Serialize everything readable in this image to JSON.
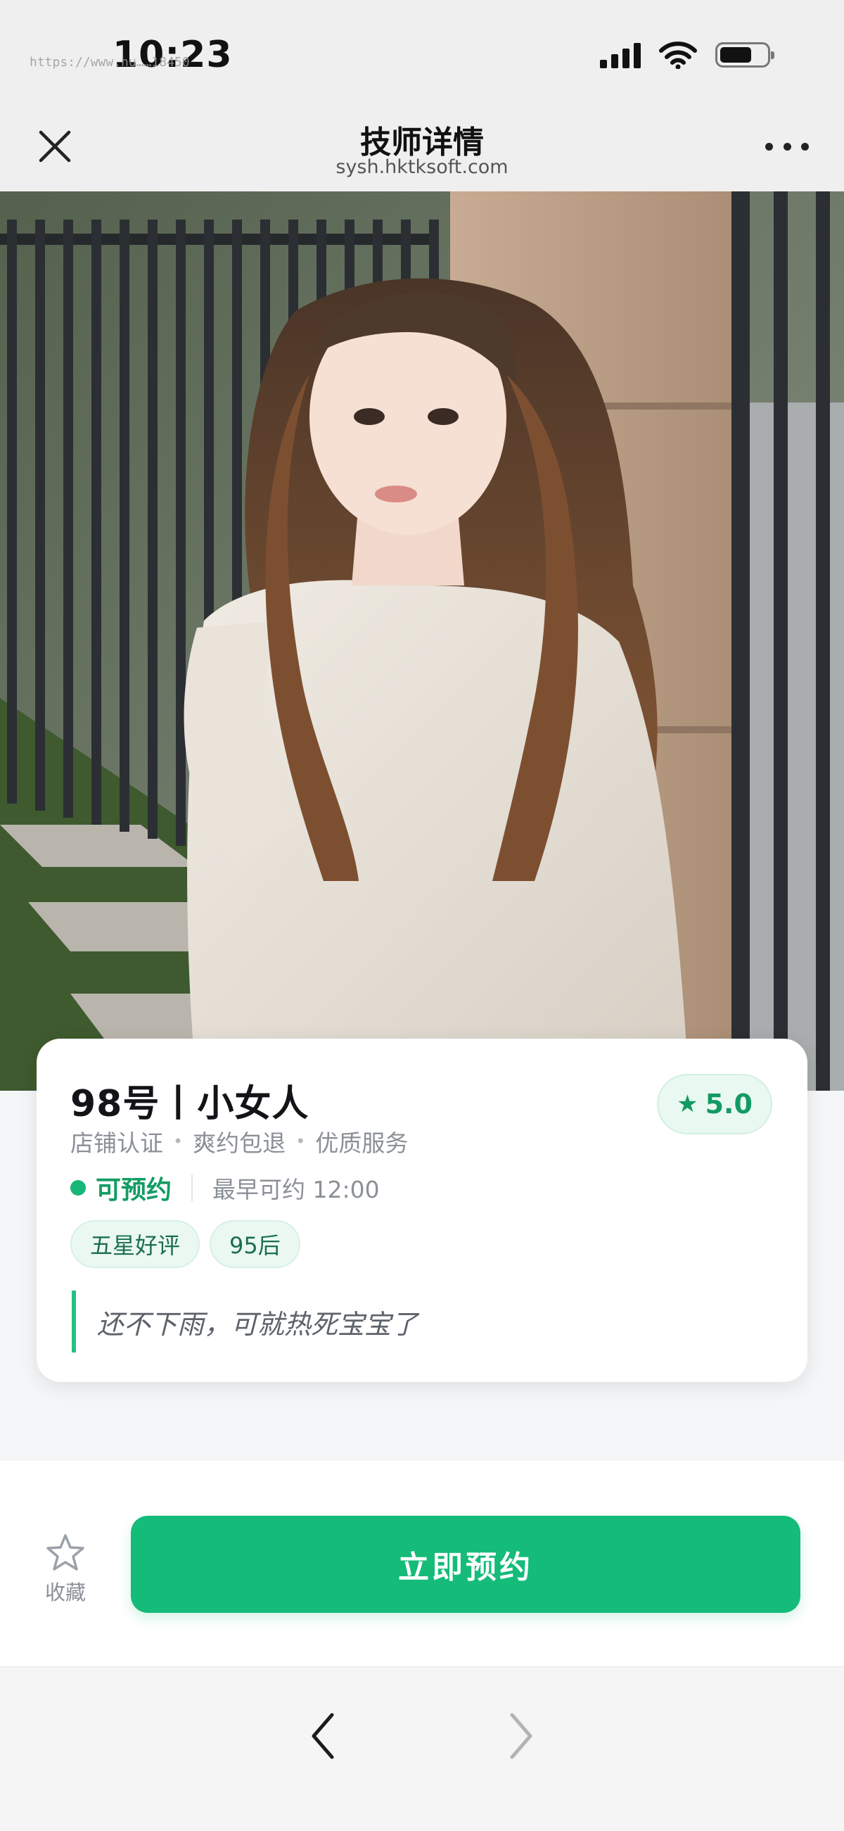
{
  "status_bar": {
    "time": "10:23",
    "url_overlay": "https://www.hu……18450",
    "icons": [
      "cellular-signal-icon",
      "wifi-icon",
      "battery-icon"
    ]
  },
  "nav": {
    "title": "技师详情",
    "subtitle": "sysh.hktksoft.com",
    "icons": [
      "close-icon",
      "more-icon"
    ]
  },
  "profile": {
    "name": "98号丨小女人",
    "rating": "5.0",
    "features": [
      "店铺认证",
      "爽约包退",
      "优质服务"
    ],
    "availability": {
      "status": "可预约",
      "earliest": "最早可约 12:00"
    },
    "tags": [
      "五星好评",
      "95后"
    ],
    "quote": "还不下雨，可就热死宝宝了"
  },
  "actions": {
    "favorite_label": "收藏",
    "book_label": "立即预约"
  },
  "toolbar": {
    "icons": [
      "chevron-left-icon",
      "chevron-right-icon"
    ],
    "forward_enabled": false
  },
  "colors": {
    "accent": "#15bb79",
    "accent_text": "#139c63",
    "tag_bg": "#ebf8f2",
    "page_bg": "#f5f6f8"
  }
}
